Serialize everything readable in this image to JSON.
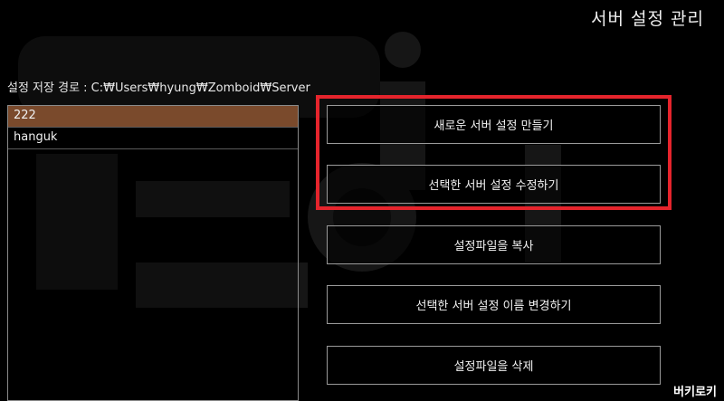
{
  "header": {
    "title": "서버 설정 관리"
  },
  "path": {
    "label": "설정 저장 경로 : C:₩Users₩hyung₩Zomboid₩Server"
  },
  "server_list": {
    "items": [
      {
        "label": "222",
        "selected": true
      },
      {
        "label": "hanguk",
        "selected": false
      }
    ]
  },
  "buttons": {
    "create": "새로운 서버 설정 만들기",
    "edit": "선택한 서버 설정 수정하기",
    "copy": "설정파일을 복사",
    "rename": "선택한 서버 설정 이름 변경하기",
    "delete": "설정파일을 삭제"
  },
  "watermark": "버키로키",
  "colors": {
    "background": "#000000",
    "selected_row": "#7a4a2c",
    "highlight_box": "#e5242c",
    "button_border": "#9a9a9a"
  }
}
